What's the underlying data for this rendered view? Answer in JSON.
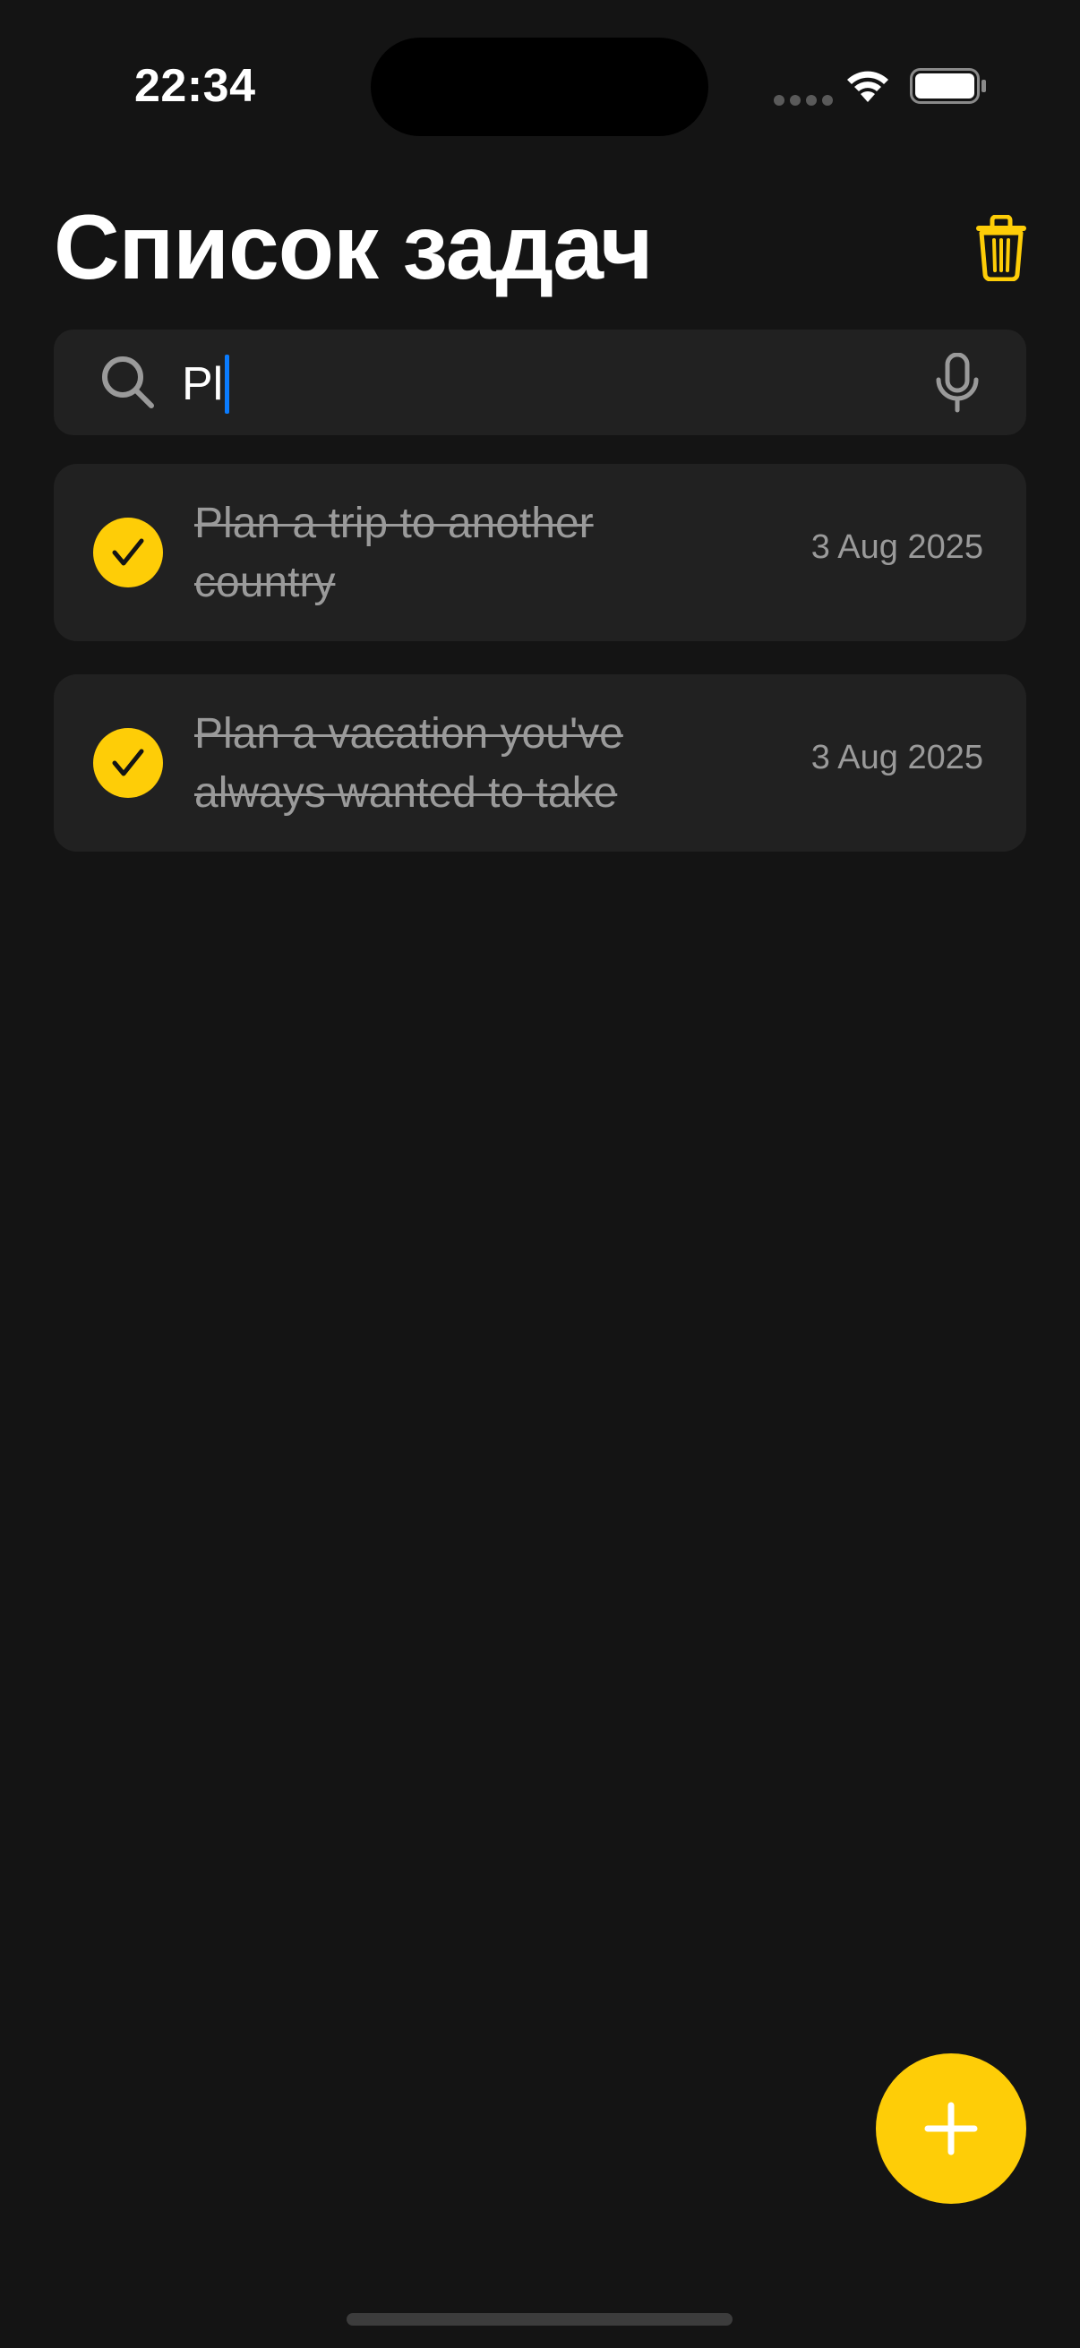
{
  "status_bar": {
    "time": "22:34",
    "icons": [
      "cellular-signal-icon",
      "wifi-icon",
      "battery-icon"
    ]
  },
  "header": {
    "title": "Список задач",
    "trash_icon": "trash-icon"
  },
  "search": {
    "value": "Pl",
    "search_icon": "search-icon",
    "mic_icon": "microphone-icon"
  },
  "tasks": [
    {
      "title": "Plan a trip to another country",
      "date": "3 Aug 2025",
      "completed": true
    },
    {
      "title": "Plan a vacation you've always wanted to take",
      "date": "3 Aug 2025",
      "completed": true
    }
  ],
  "fab": {
    "icon": "plus-icon"
  },
  "colors": {
    "background": "#141414",
    "card": "#212121",
    "accent": "#fecd07",
    "muted_text": "#9a9a9a",
    "caret": "#0a7cff"
  }
}
